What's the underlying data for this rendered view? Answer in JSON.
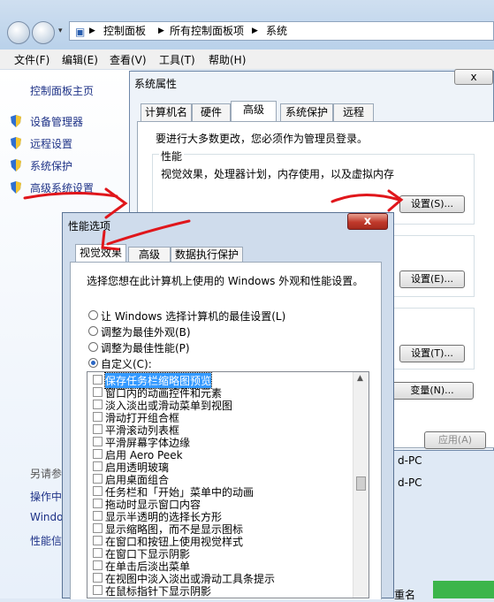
{
  "address": {
    "segments": [
      "控制面板",
      "所有控制面板项",
      "系统"
    ]
  },
  "menu": [
    "文件(F)",
    "编辑(E)",
    "查看(V)",
    "工具(T)",
    "帮助(H)"
  ],
  "sidebar": {
    "home": "控制面板主页",
    "items": [
      "设备管理器",
      "远程设置",
      "系统保护",
      "高级系统设置"
    ],
    "see_also": [
      "另请参",
      "操作中",
      "Windo",
      "性能信"
    ]
  },
  "system_props": {
    "title": "系统属性",
    "close": "x",
    "tabs": [
      "计算机名",
      "硬件",
      "高级",
      "系统保护",
      "远程"
    ],
    "admin_note": "要进行大多数更改，您必须作为管理员登录。",
    "perf_group_title": "性能",
    "perf_desc": "视觉效果，处理器计划，内存使用，以及虚拟内存",
    "settings_s": "设置(S)...",
    "settings_e": "设置(E)...",
    "settings_t": "设置(T)...",
    "env_vars": "变量(N)...",
    "apply": "应用(A)",
    "side_text": [
      "d-PC",
      "d-PC"
    ],
    "bottom_text": "重名"
  },
  "perf_options": {
    "title": "性能选项",
    "close": "x",
    "tabs": [
      "视觉效果",
      "高级",
      "数据执行保护"
    ],
    "intro": "选择您想在此计算机上使用的 Windows 外观和性能设置。",
    "radios": [
      {
        "label": "让 Windows 选择计算机的最佳设置(L)",
        "checked": false
      },
      {
        "label": "调整为最佳外观(B)",
        "checked": false
      },
      {
        "label": "调整为最佳性能(P)",
        "checked": false
      },
      {
        "label": "自定义(C):",
        "checked": true
      }
    ],
    "checkboxes": [
      "保存任务栏缩略图预览",
      "窗口内的动画控件和元素",
      "淡入淡出或滑动菜单到视图",
      "滑动打开组合框",
      "平滑滚动列表框",
      "平滑屏幕字体边缘",
      "启用 Aero Peek",
      "启用透明玻璃",
      "启用桌面组合",
      "任务栏和「开始」菜单中的动画",
      "拖动时显示窗口内容",
      "显示半透明的选择长方形",
      "显示缩略图，而不是显示图标",
      "在窗口和按钮上使用视觉样式",
      "在窗口下显示阴影",
      "在单击后淡出菜单",
      "在视图中淡入淡出或滑动工具条提示",
      "在鼠标指针下显示阴影"
    ]
  },
  "colors": {
    "accent": "#3399ff",
    "annotation": "#e0161b",
    "link": "#1e3287"
  }
}
